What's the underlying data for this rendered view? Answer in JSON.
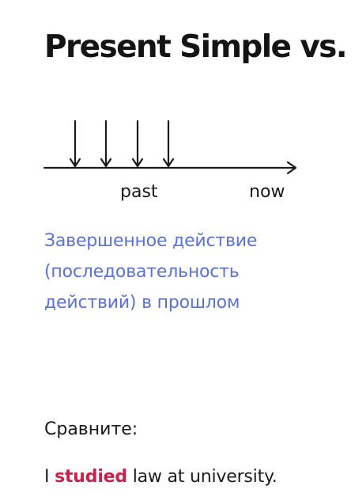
{
  "title": "Present Simple vs.",
  "timeline": {
    "label_past": "past",
    "label_now": "now",
    "event_arrows": 4
  },
  "description": {
    "lines": [
      "Завершенное действие",
      "(последовательность",
      "действий) в прошлом"
    ]
  },
  "compare_label": "Сравните:",
  "example": {
    "before": "I ",
    "highlight": "studied",
    "after": " law at university."
  },
  "colors": {
    "text": "#161616",
    "description": "#5b72d4",
    "highlight": "#c9214b"
  }
}
